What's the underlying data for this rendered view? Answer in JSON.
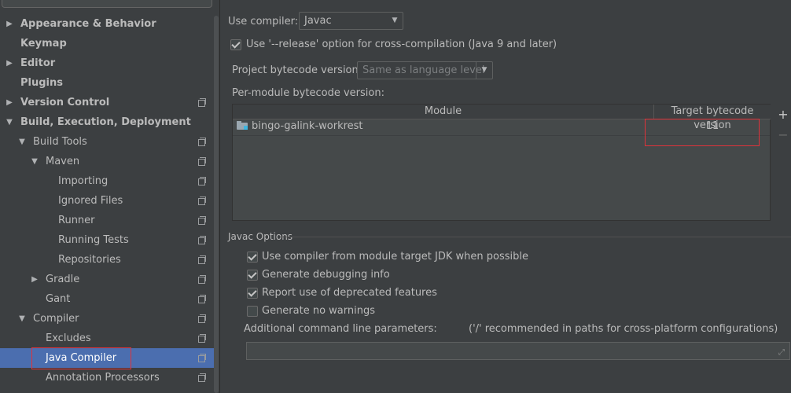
{
  "sidebar": {
    "items": [
      {
        "label": "Appearance & Behavior",
        "bold": true,
        "arrow": "▶",
        "indent": 0,
        "proj": false
      },
      {
        "label": "Keymap",
        "bold": true,
        "arrow": "",
        "indent": 0,
        "proj": false
      },
      {
        "label": "Editor",
        "bold": true,
        "arrow": "▶",
        "indent": 0,
        "proj": false
      },
      {
        "label": "Plugins",
        "bold": true,
        "arrow": "",
        "indent": 0,
        "proj": false
      },
      {
        "label": "Version Control",
        "bold": true,
        "arrow": "▶",
        "indent": 0,
        "proj": true
      },
      {
        "label": "Build, Execution, Deployment",
        "bold": true,
        "arrow": "▼",
        "indent": 0,
        "proj": false
      },
      {
        "label": "Build Tools",
        "bold": false,
        "arrow": "▼",
        "indent": 1,
        "proj": true
      },
      {
        "label": "Maven",
        "bold": false,
        "arrow": "▼",
        "indent": 2,
        "proj": true
      },
      {
        "label": "Importing",
        "bold": false,
        "arrow": "",
        "indent": 3,
        "proj": true
      },
      {
        "label": "Ignored Files",
        "bold": false,
        "arrow": "",
        "indent": 3,
        "proj": true
      },
      {
        "label": "Runner",
        "bold": false,
        "arrow": "",
        "indent": 3,
        "proj": true
      },
      {
        "label": "Running Tests",
        "bold": false,
        "arrow": "",
        "indent": 3,
        "proj": true
      },
      {
        "label": "Repositories",
        "bold": false,
        "arrow": "",
        "indent": 3,
        "proj": true
      },
      {
        "label": "Gradle",
        "bold": false,
        "arrow": "▶",
        "indent": 2,
        "proj": true
      },
      {
        "label": "Gant",
        "bold": false,
        "arrow": "",
        "indent": 2,
        "proj": true
      },
      {
        "label": "Compiler",
        "bold": false,
        "arrow": "▼",
        "indent": 1,
        "proj": true
      },
      {
        "label": "Excludes",
        "bold": false,
        "arrow": "",
        "indent": 2,
        "proj": true
      },
      {
        "label": "Java Compiler",
        "bold": false,
        "arrow": "",
        "indent": 2,
        "proj": true,
        "selected": true
      },
      {
        "label": "Annotation Processors",
        "bold": false,
        "arrow": "",
        "indent": 2,
        "proj": true
      }
    ]
  },
  "main": {
    "use_compiler_label": "Use compiler:",
    "compiler_value": "Javac",
    "release_option_label": "Use '--release' option for cross-compilation (Java 9 and later)",
    "release_option_checked": true,
    "project_bytecode_label": "Project bytecode version:",
    "project_bytecode_value": "Same as language level",
    "per_module_label": "Per-module bytecode version:",
    "table": {
      "columns": [
        "Module",
        "Target bytecode version"
      ],
      "rows": [
        {
          "module": "bingo-galink-workrest",
          "version": "11"
        }
      ]
    },
    "add_label": "+",
    "remove_label": "−",
    "javac_section_title": "Javac Options",
    "javac_options": [
      {
        "label": "Use compiler from module target JDK when possible",
        "checked": true
      },
      {
        "label": "Generate debugging info",
        "checked": true
      },
      {
        "label": "Report use of deprecated features",
        "checked": true
      },
      {
        "label": "Generate no warnings",
        "checked": false
      }
    ],
    "additional_params_label": "Additional command line parameters:",
    "additional_params_hint": "('/' recommended in paths for cross-platform configurations)",
    "additional_params_value": ""
  },
  "colors": {
    "selection": "#4b6eaf",
    "highlight_box": "#e0323a",
    "background": "#3c3f41"
  }
}
